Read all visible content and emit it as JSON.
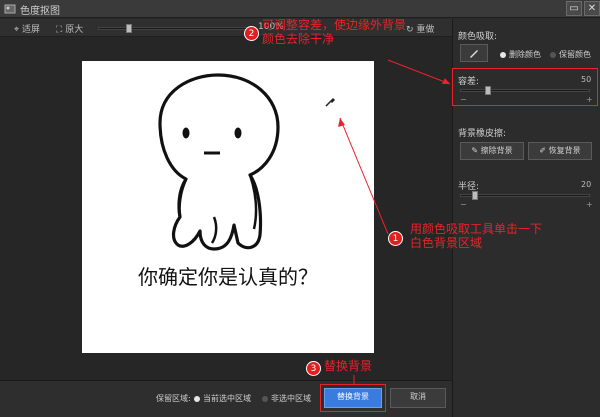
{
  "window": {
    "title": "色度抠图",
    "minimize": "▭",
    "close": "✕"
  },
  "toolbar": {
    "fit": "适屏",
    "original": "原大",
    "zoom": "100%",
    "redo": "重做"
  },
  "right_panel": {
    "color_pick": {
      "label": "颜色吸取:",
      "option_remove": "删除颜色",
      "option_keep": "保留颜色"
    },
    "tolerance": {
      "label": "容差:",
      "value": "50",
      "level": 0.2,
      "minus": "−",
      "plus": "+"
    },
    "eraser": {
      "label": "背景橡皮擦:",
      "erase_button": "擦除背景",
      "restore_button": "恢复背景"
    },
    "radius": {
      "label": "半径:",
      "value": "20",
      "level": 0.1,
      "minus": "−",
      "plus": "+"
    }
  },
  "image": {
    "caption": "你确定你是认真的？"
  },
  "bottom": {
    "keep_label": "保留区域:",
    "option_selected": "当前选中区域",
    "option_unselected": "非选中区域",
    "replace_button": "替换背景",
    "cancel_button": "取消"
  },
  "annotations": {
    "step1": {
      "num": "1",
      "line1": "用颜色吸取工具单击一下",
      "line2": "白色背景区域"
    },
    "step2": {
      "num": "2",
      "line1": "可调整容差，使边缘外背景",
      "line2": "颜色去除干净"
    },
    "step3": {
      "num": "3",
      "text": "替换背景"
    }
  },
  "colors": {
    "accent": "#3a7be0",
    "annotation": "#e8232b"
  }
}
